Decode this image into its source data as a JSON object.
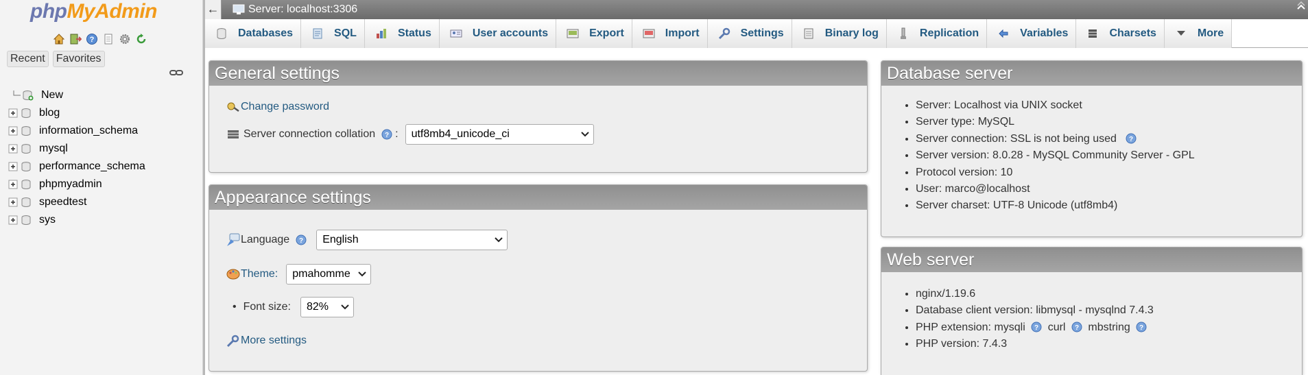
{
  "nav": {
    "logo_php": "php",
    "logo_myadmin": "MyAdmin",
    "quick_icons": [
      "home-icon",
      "logout-icon",
      "help-icon",
      "docs-icon",
      "settings-icon",
      "reload-icon"
    ],
    "tabs": [
      "Recent",
      "Favorites"
    ],
    "tree": {
      "new_label": "New",
      "databases": [
        "blog",
        "information_schema",
        "mysql",
        "performance_schema",
        "phpmyadmin",
        "speedtest",
        "sys"
      ]
    }
  },
  "serverbar": {
    "back": "←",
    "title": "Server: localhost:3306"
  },
  "topmenu": {
    "tabs": [
      {
        "label": "Databases",
        "icon": "database-icon"
      },
      {
        "label": "SQL",
        "icon": "sql-icon"
      },
      {
        "label": "Status",
        "icon": "status-icon"
      },
      {
        "label": "User accounts",
        "icon": "users-icon"
      },
      {
        "label": "Export",
        "icon": "export-icon"
      },
      {
        "label": "Import",
        "icon": "import-icon"
      },
      {
        "label": "Settings",
        "icon": "wrench-icon"
      },
      {
        "label": "Binary log",
        "icon": "binlog-icon"
      },
      {
        "label": "Replication",
        "icon": "replication-icon"
      },
      {
        "label": "Variables",
        "icon": "variables-icon"
      },
      {
        "label": "Charsets",
        "icon": "charsets-icon"
      },
      {
        "label": "More",
        "icon": "more-icon"
      }
    ]
  },
  "general": {
    "title": "General settings",
    "change_password": "Change password",
    "collation_label": "Server connection collation",
    "collation_colon": ":",
    "collation_value": "utf8mb4_unicode_ci"
  },
  "appearance": {
    "title": "Appearance settings",
    "language_label": "Language",
    "language_value": "English",
    "theme_label": "Theme:",
    "theme_value": "pmahomme",
    "fontsize_label": "Font size:",
    "fontsize_value": "82%",
    "more_settings": "More settings"
  },
  "dbserver": {
    "title": "Database server",
    "items": [
      "Server: Localhost via UNIX socket",
      "Server type: MySQL",
      "Server connection: SSL is not being used",
      "Server version: 8.0.28 - MySQL Community Server - GPL",
      "Protocol version: 10",
      "User: marco@localhost",
      "Server charset: UTF-8 Unicode (utf8mb4)"
    ]
  },
  "webserver": {
    "title": "Web server",
    "nginx": "nginx/1.19.6",
    "client": "Database client version: libmysql - mysqlnd 7.4.3",
    "php_ext_label": "PHP extension:",
    "ext1": "mysqli",
    "ext2": "curl",
    "ext3": "mbstring",
    "php_version": "PHP version: 7.4.3"
  },
  "colors": {
    "link": "#235a81",
    "panel_header": "#9a9a9a",
    "panel_bg": "#eeeeee",
    "serverbar": "#7b7b7b"
  }
}
